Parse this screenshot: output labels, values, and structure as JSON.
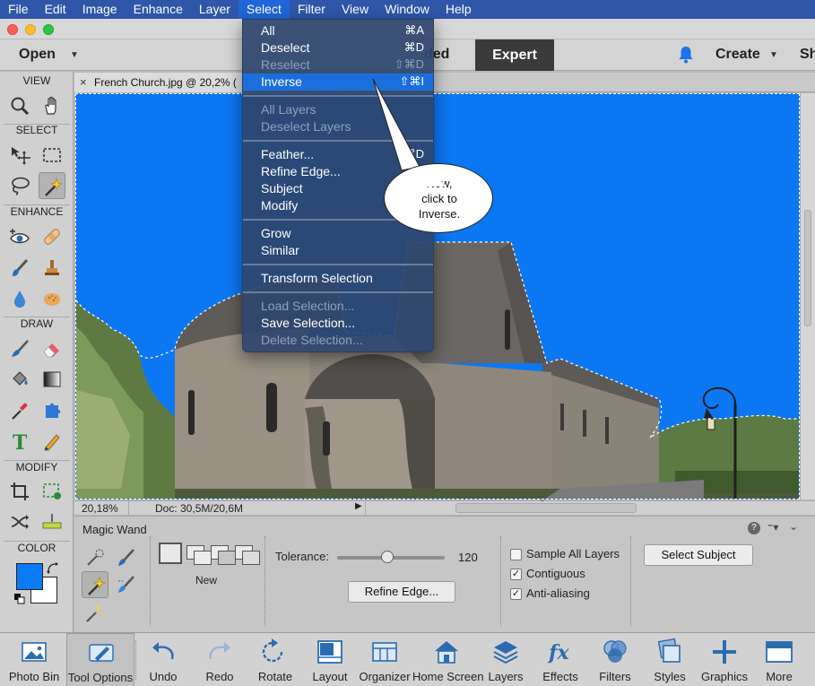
{
  "menubar": {
    "items": [
      "File",
      "Edit",
      "Image",
      "Enhance",
      "Layer",
      "Select",
      "Filter",
      "View",
      "Window",
      "Help"
    ],
    "active": "Select"
  },
  "appbar": {
    "open_label": "Open",
    "guided_label": "ded",
    "expert_label": "Expert",
    "create_label": "Create",
    "share_label": "Sh"
  },
  "toolbox": {
    "view_label": "VIEW",
    "select_label": "SELECT",
    "enhance_label": "ENHANCE",
    "draw_label": "DRAW",
    "modify_label": "MODIFY",
    "color_label": "COLOR",
    "foreground_color": "#0a7bf5",
    "background_color": "#ffffff"
  },
  "document": {
    "tab_title": "French Church.jpg @ 20,2% (",
    "zoom": "20,18%",
    "doc_info": "Doc: 30,5M/20,6M"
  },
  "select_menu": {
    "items": [
      {
        "label": "All",
        "shortcut": "⌘A",
        "disabled": false
      },
      {
        "label": "Deselect",
        "shortcut": "⌘D",
        "disabled": false
      },
      {
        "label": "Reselect",
        "shortcut": "⇧⌘D",
        "disabled": true
      },
      {
        "label": "Inverse",
        "shortcut": "⇧⌘I",
        "disabled": false,
        "highlighted": true
      },
      {
        "label": "All Layers",
        "shortcut": "",
        "disabled": true
      },
      {
        "label": "Deselect Layers",
        "shortcut": "",
        "disabled": true
      },
      {
        "label": "Feather...",
        "shortcut": "⌘D",
        "disabled": false
      },
      {
        "label": "Refine Edge...",
        "shortcut": "",
        "disabled": false
      },
      {
        "label": "Subject",
        "shortcut": "",
        "disabled": false
      },
      {
        "label": "Modify",
        "shortcut": "",
        "disabled": false
      },
      {
        "label": "Grow",
        "shortcut": "",
        "disabled": false
      },
      {
        "label": "Similar",
        "shortcut": "",
        "disabled": false
      },
      {
        "label": "Transform Selection",
        "shortcut": "",
        "disabled": false
      },
      {
        "label": "Load Selection...",
        "shortcut": "",
        "disabled": true
      },
      {
        "label": "Save Selection...",
        "shortcut": "",
        "disabled": false
      },
      {
        "label": "Delete Selection...",
        "shortcut": "",
        "disabled": true
      }
    ]
  },
  "callout": {
    "text": "Now,\nclick to\nInverse."
  },
  "tool_options": {
    "title": "Magic Wand",
    "mode_label": "New",
    "tolerance_label": "Tolerance:",
    "tolerance_value": "120",
    "tolerance_fraction": 0.47,
    "refine_edge_label": "Refine Edge...",
    "sample_all_layers_label": "Sample All Layers",
    "sample_all_layers_checked": false,
    "contiguous_label": "Contiguous",
    "contiguous_checked": true,
    "anti_aliasing_label": "Anti-aliasing",
    "anti_aliasing_checked": true,
    "select_subject_label": "Select Subject",
    "help_glyph": "?"
  },
  "taskbar": {
    "items": [
      {
        "label": "Photo Bin",
        "icon": "photo-bin-icon"
      },
      {
        "label": "Tool Options",
        "icon": "tool-options-icon",
        "selected": true
      },
      {
        "label": "Undo",
        "icon": "undo-icon"
      },
      {
        "label": "Redo",
        "icon": "redo-icon"
      },
      {
        "label": "Rotate",
        "icon": "rotate-icon"
      },
      {
        "label": "Layout",
        "icon": "layout-icon"
      },
      {
        "label": "Organizer",
        "icon": "organizer-icon"
      },
      {
        "label": "Home Screen",
        "icon": "home-screen-icon"
      },
      {
        "label": "Layers",
        "icon": "layers-icon"
      },
      {
        "label": "Effects",
        "icon": "effects-icon"
      },
      {
        "label": "Filters",
        "icon": "filters-icon"
      },
      {
        "label": "Styles",
        "icon": "styles-icon"
      },
      {
        "label": "Graphics",
        "icon": "graphics-icon"
      },
      {
        "label": "More",
        "icon": "more-icon"
      }
    ]
  },
  "colors": {
    "accent": "#1b6fdc",
    "selection_fill": "#0b77f2",
    "menubar": "#2f56a8"
  }
}
